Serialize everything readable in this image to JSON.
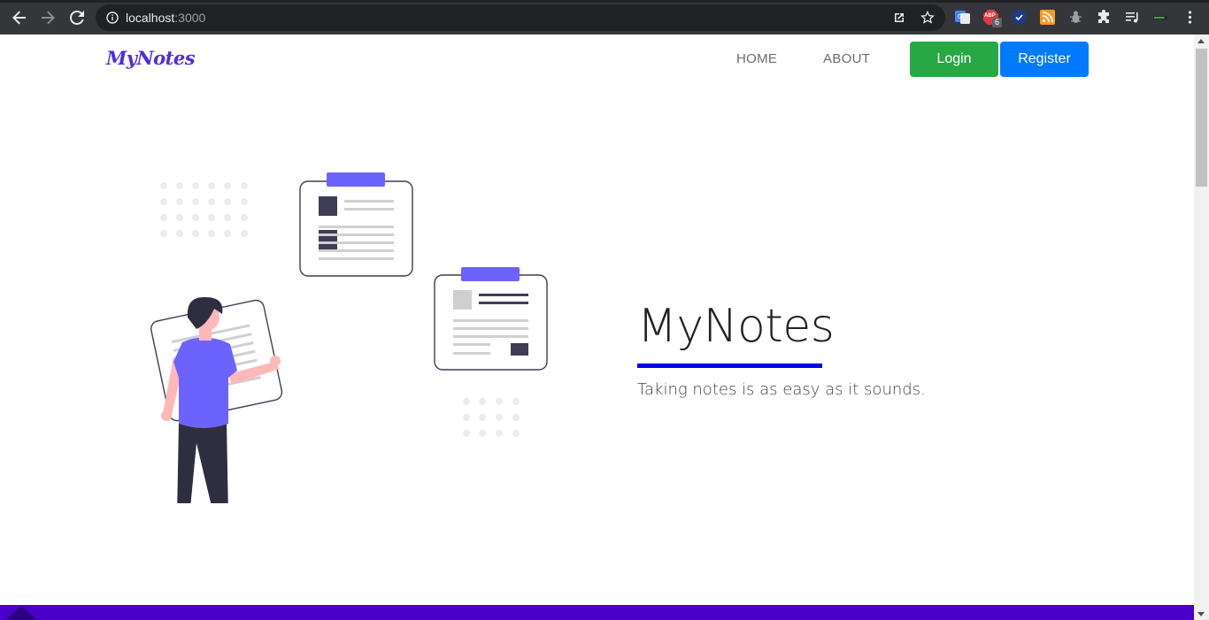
{
  "browser": {
    "url_host": "localhost",
    "url_port": ":3000",
    "extension_badge": "6",
    "extension_badge_text": "ABP"
  },
  "navbar": {
    "brand": "MyNotes",
    "links": [
      "HOME",
      "ABOUT"
    ],
    "login_label": "Login",
    "register_label": "Register"
  },
  "hero": {
    "title": "MyNotes",
    "subtitle": "Taking notes is as easy as it sounds."
  },
  "colors": {
    "brand": "#4b2de6",
    "login": "#28a745",
    "register": "#007bff",
    "underline": "#0000e6",
    "footer": "#4a00c8",
    "illustration_accent": "#6c63ff"
  },
  "icons": {
    "back": "arrow-left-icon",
    "forward": "arrow-right-icon",
    "reload": "reload-icon",
    "site_info": "info-icon",
    "open_external": "external-link-icon",
    "bookmark": "star-icon",
    "translate": "translate-icon",
    "adblock": "adblock-icon",
    "check": "check-icon",
    "rss": "rss-icon",
    "bug": "bug-icon",
    "extensions": "puzzle-icon",
    "media": "media-icon",
    "battery": "battery-icon",
    "menu": "kebab-menu-icon"
  }
}
